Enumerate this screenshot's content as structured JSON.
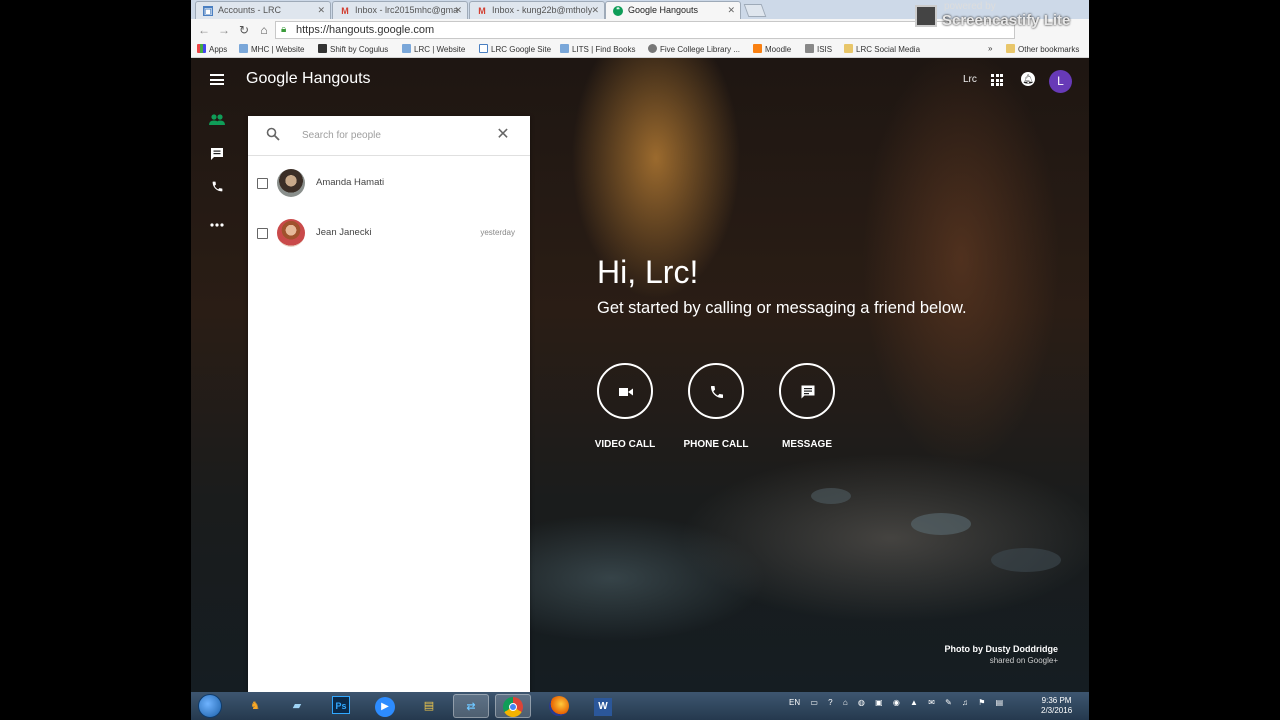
{
  "tabs": [
    {
      "label": "Accounts - LRC",
      "active": false
    },
    {
      "label": "Inbox - lrc2015mhc@gma",
      "active": false
    },
    {
      "label": "Inbox - kung22b@mtholy",
      "active": false
    },
    {
      "label": "Google Hangouts",
      "active": true
    }
  ],
  "omnibox": {
    "url": "https://hangouts.google.com"
  },
  "bookmarks": [
    {
      "label": "Apps"
    },
    {
      "label": "MHC | Website"
    },
    {
      "label": "Shift by Cogulus"
    },
    {
      "label": "LRC | Website"
    },
    {
      "label": "LRC Google Site"
    },
    {
      "label": "LITS | Find Books"
    },
    {
      "label": "Five College Library ..."
    },
    {
      "label": "Moodle"
    },
    {
      "label": "ISIS"
    },
    {
      "label": "LRC Social Media"
    },
    {
      "label": "Other bookmarks"
    }
  ],
  "bookmarks_overflow": "»",
  "screencastify": {
    "line1": "powered by",
    "line2": "Screencastify Lite"
  },
  "app": {
    "brand": "Google Hangouts",
    "account_name": "Lrc",
    "avatar_letter": "L"
  },
  "search": {
    "placeholder": "Search for people",
    "value": ""
  },
  "contacts": [
    {
      "name": "Amanda Hamati",
      "time": ""
    },
    {
      "name": "Jean Janecki",
      "time": "yesterday"
    }
  ],
  "welcome": {
    "title": "Hi, Lrc!",
    "subtitle": "Get started by calling or messaging a friend below."
  },
  "actions": [
    {
      "label": "VIDEO CALL",
      "icon": "videocam-icon"
    },
    {
      "label": "PHONE CALL",
      "icon": "phone-icon"
    },
    {
      "label": "MESSAGE",
      "icon": "message-icon"
    }
  ],
  "credit": {
    "line1": "Photo by Dusty Doddridge",
    "line2": "shared on Google+"
  },
  "taskbar": {
    "lang": "EN",
    "time": "9:36 PM",
    "date": "2/3/2016"
  },
  "colors": {
    "accent_green": "#0f9d58",
    "avatar_purple": "#673ab7"
  }
}
